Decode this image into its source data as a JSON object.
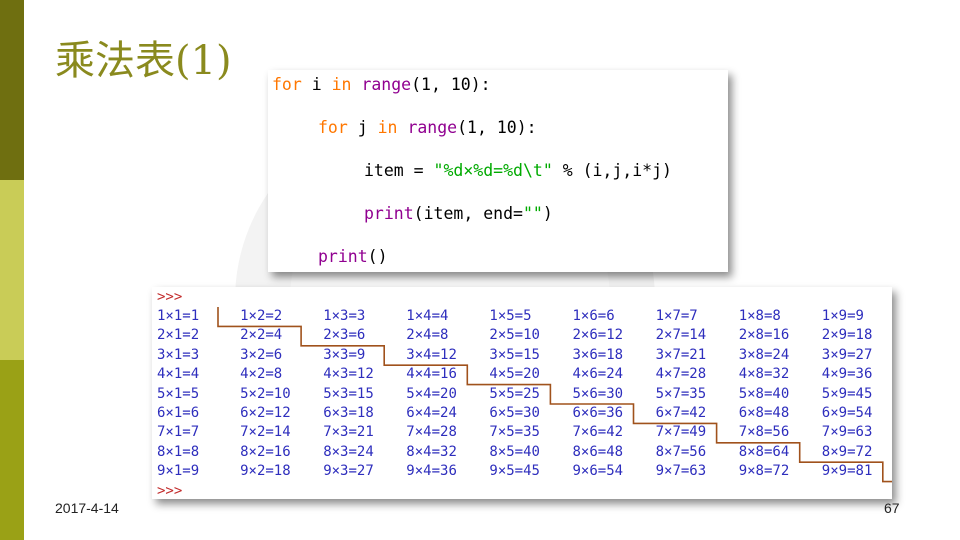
{
  "slide": {
    "title": "乘法表(1)",
    "date": "2017-4-14",
    "page_number": "67"
  },
  "code": {
    "line1": {
      "kw1": "for",
      "t1": " i ",
      "kw2": "in",
      "t2": " ",
      "bi": "range",
      "t3": "(1, 10):"
    },
    "line2": {
      "kw1": "for",
      "t1": " j ",
      "kw2": "in",
      "t2": " ",
      "bi": "range",
      "t3": "(1, 10):"
    },
    "line3": {
      "t1": "item = ",
      "st": "\"%d×%d=%d\\t\"",
      "t2": " % (i,j,i*j)"
    },
    "line4": {
      "bi": "print",
      "t1": "(item, end=",
      "st": "\"\"",
      "t2": ")"
    },
    "line5": {
      "bi": "print",
      "t1": "()"
    }
  },
  "output": {
    "prompt": ">>>",
    "rows": [
      [
        "1×1=1",
        "1×2=2",
        "1×3=3",
        "1×4=4",
        "1×5=5",
        "1×6=6",
        "1×7=7",
        "1×8=8",
        "1×9=9"
      ],
      [
        "2×1=2",
        "2×2=4",
        "2×3=6",
        "2×4=8",
        "2×5=10",
        "2×6=12",
        "2×7=14",
        "2×8=16",
        "2×9=18"
      ],
      [
        "3×1=3",
        "3×2=6",
        "3×3=9",
        "3×4=12",
        "3×5=15",
        "3×6=18",
        "3×7=21",
        "3×8=24",
        "3×9=27"
      ],
      [
        "4×1=4",
        "4×2=8",
        "4×3=12",
        "4×4=16",
        "4×5=20",
        "4×6=24",
        "4×7=28",
        "4×8=32",
        "4×9=36"
      ],
      [
        "5×1=5",
        "5×2=10",
        "5×3=15",
        "5×4=20",
        "5×5=25",
        "5×6=30",
        "5×7=35",
        "5×8=40",
        "5×9=45"
      ],
      [
        "6×1=6",
        "6×2=12",
        "6×3=18",
        "6×4=24",
        "6×5=30",
        "6×6=36",
        "6×7=42",
        "6×8=48",
        "6×9=54"
      ],
      [
        "7×1=7",
        "7×2=14",
        "7×3=21",
        "7×4=28",
        "7×5=35",
        "7×6=42",
        "7×7=49",
        "7×8=56",
        "7×9=63"
      ],
      [
        "8×1=8",
        "8×2=16",
        "8×3=24",
        "8×4=32",
        "8×5=40",
        "8×6=48",
        "8×7=56",
        "8×8=64",
        "8×9=72"
      ],
      [
        "9×1=9",
        "9×2=18",
        "9×3=27",
        "9×4=36",
        "9×5=45",
        "9×6=54",
        "9×7=63",
        "9×8=72",
        "9×9=81"
      ]
    ]
  },
  "colors": {
    "keyword": "#ff7700",
    "builtin": "#900090",
    "string": "#00aa00",
    "output_text": "#2e2ebd",
    "prompt": "#c22b2b",
    "staircase_line": "#a0521c",
    "title": "#8a8a1e"
  }
}
